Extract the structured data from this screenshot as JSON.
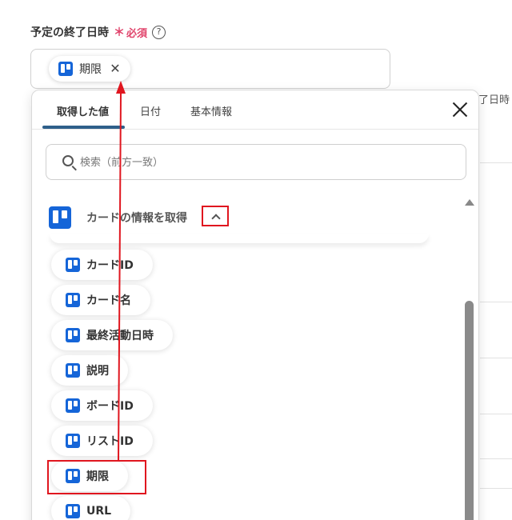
{
  "field": {
    "label": "予定の終了日時",
    "required_mark": "＊",
    "required_text": "必須",
    "help": "?"
  },
  "selected_chip": {
    "label": "期限",
    "close": "✕"
  },
  "background_fragment": "了日時",
  "tabs": [
    {
      "label": "取得した値"
    },
    {
      "label": "日付"
    },
    {
      "label": "基本情報"
    }
  ],
  "search": {
    "placeholder": "検索（前方一致）",
    "value": ""
  },
  "section": {
    "label": "カードの情報を取得"
  },
  "items": [
    {
      "label": "カードID"
    },
    {
      "label": "カード名"
    },
    {
      "label": "最終活動日時"
    },
    {
      "label": "説明"
    },
    {
      "label": "ボードID"
    },
    {
      "label": "リストID"
    },
    {
      "label": "期限"
    },
    {
      "label": "URL"
    }
  ],
  "colors": {
    "accent_red": "#e0161f",
    "trello_blue": "#1565d8",
    "tab_underline": "#2e5f8a",
    "required": "#e0436b"
  }
}
